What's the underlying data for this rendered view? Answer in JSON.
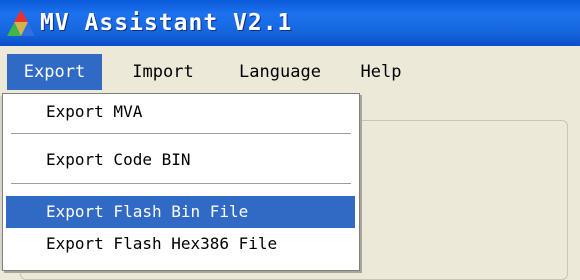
{
  "window": {
    "title": "MV Assistant V2.1",
    "icon": "app-triangle-icon"
  },
  "menubar": {
    "items": [
      {
        "label": "Export",
        "active": true
      },
      {
        "label": "Import",
        "active": false
      },
      {
        "label": "Language",
        "active": false
      },
      {
        "label": "Help",
        "active": false
      }
    ]
  },
  "export_menu": {
    "items": [
      {
        "label": "Export MVA",
        "highlighted": false
      },
      {
        "label": "Export Code BIN",
        "highlighted": false
      },
      {
        "label": "Export Flash Bin File",
        "highlighted": true
      },
      {
        "label": "Export Flash Hex386 File",
        "highlighted": false
      }
    ]
  },
  "colors": {
    "titlebar": "#1665df",
    "highlight": "#316ac5",
    "menu_background": "#ece9d8"
  }
}
